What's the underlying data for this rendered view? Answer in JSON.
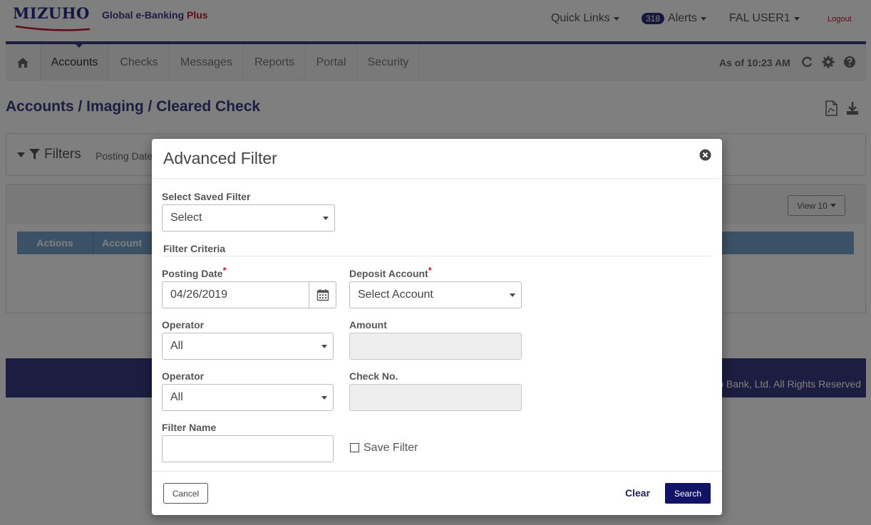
{
  "brand": {
    "logo_text": "MIZUHO",
    "product_name": "Global e-Banking ",
    "product_suffix": "Plus"
  },
  "top_links": {
    "quick_links": "Quick Links",
    "alerts_count": "318",
    "alerts": "Alerts",
    "user": "FAL USER1",
    "logout": "Logout"
  },
  "nav": {
    "home_icon": "home-icon",
    "items": [
      {
        "label": "Accounts",
        "active": true
      },
      {
        "label": "Checks"
      },
      {
        "label": "Messages"
      },
      {
        "label": "Reports"
      },
      {
        "label": "Portal"
      },
      {
        "label": "Security"
      }
    ],
    "as_of": "As of 10:23 AM",
    "icons": [
      "refresh-icon",
      "gear-icon",
      "help-icon"
    ]
  },
  "page": {
    "title": "Accounts / Imaging / Cleared Check",
    "filters_label": "Filters",
    "filters_summary": "Posting Date",
    "view_button": "View 10",
    "table_headers": [
      "Actions",
      "Account"
    ],
    "footer_text": "o Bank, Ltd. All Rights Reserved"
  },
  "modal": {
    "title": "Advanced Filter",
    "saved_filter_label": "Select Saved Filter",
    "saved_filter_value": "Select",
    "criteria_heading": "Filter Criteria",
    "posting_date_label": "Posting Date",
    "posting_date_value": "04/26/2019",
    "deposit_account_label": "Deposit Account",
    "deposit_account_value": "Select Account",
    "operator1_label": "Operator",
    "operator1_value": "All",
    "amount_label": "Amount",
    "amount_value": "",
    "operator2_label": "Operator",
    "operator2_value": "All",
    "check_no_label": "Check No.",
    "check_no_value": "",
    "filter_name_label": "Filter Name",
    "filter_name_value": "",
    "save_filter_label": "Save Filter",
    "save_filter_checked": false,
    "required_mark": "*",
    "buttons": {
      "cancel": "Cancel",
      "clear": "Clear",
      "search": "Search"
    }
  },
  "colors": {
    "brand_navy": "#3b3a82",
    "accent_red": "#c0192f",
    "table_header": "#76a4cd",
    "search_button": "#131365"
  }
}
